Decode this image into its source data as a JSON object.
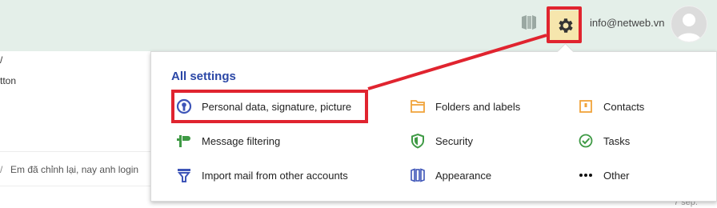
{
  "header": {
    "email": "info@netweb.vn",
    "accent_color": "#e4efe9"
  },
  "background": {
    "fragment_1": "/",
    "fragment_2": "tton",
    "fragment_3": "/",
    "preview_text": "Em đã chỉnh lại, nay anh login",
    "date": "7 sep."
  },
  "settings_menu": {
    "title": "All settings",
    "columns": [
      [
        {
          "label": "Personal data, signature, picture",
          "icon": "person-icon"
        },
        {
          "label": "Message filtering",
          "icon": "filter-icon"
        },
        {
          "label": "Import mail from other accounts",
          "icon": "import-icon"
        }
      ],
      [
        {
          "label": "Folders and labels",
          "icon": "folder-icon"
        },
        {
          "label": "Security",
          "icon": "shield-icon"
        },
        {
          "label": "Appearance",
          "icon": "appearance-icon"
        }
      ],
      [
        {
          "label": "Contacts",
          "icon": "contacts-icon"
        },
        {
          "label": "Tasks",
          "icon": "tasks-icon"
        },
        {
          "label": "Other",
          "icon": "more-icon"
        }
      ]
    ]
  },
  "highlight_color": "#e0242f"
}
